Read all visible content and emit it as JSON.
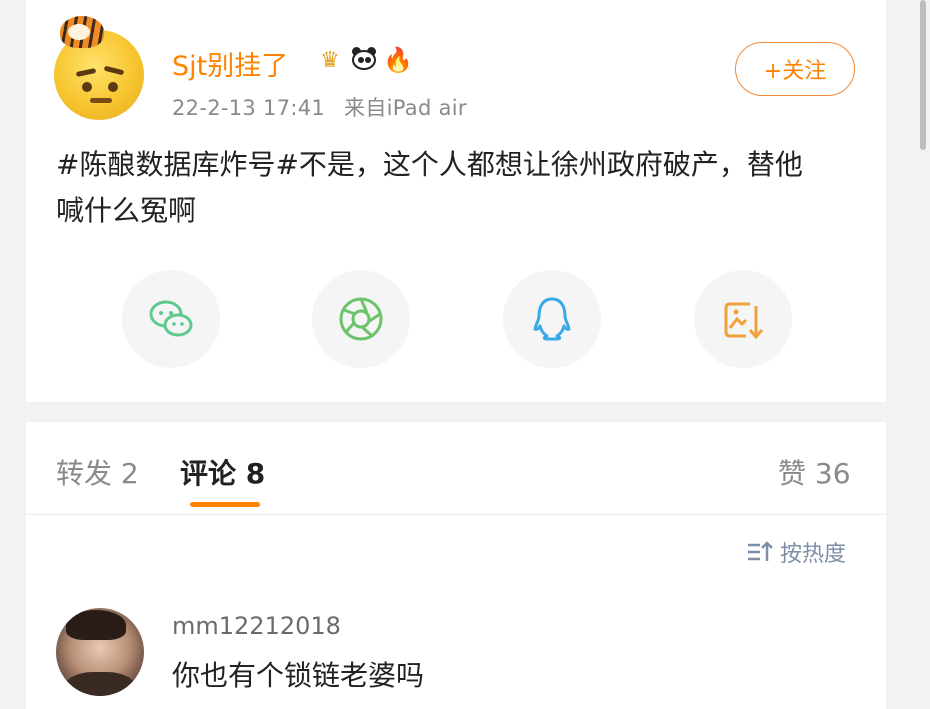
{
  "post": {
    "username": "Sjt别挂了",
    "badges": [
      "crown-badge",
      "panda-badge",
      "fire-badge"
    ],
    "timestamp": "22-2-13 17:41",
    "source": "来自iPad air",
    "follow_label": "+关注",
    "text": "#陈酿数据库炸号#不是，这个人都想让徐州政府破产，替他喊什么冤啊"
  },
  "share": [
    {
      "icon": "wechat-icon",
      "color": "#5cc98f"
    },
    {
      "icon": "moments-icon",
      "color": "#6cc36a"
    },
    {
      "icon": "qq-icon",
      "color": "#3aa7e6"
    },
    {
      "icon": "save-image-icon",
      "color": "#f0a23a"
    }
  ],
  "tabs": {
    "repost": "转发 2",
    "comments": "评论 8",
    "likes": "赞 36"
  },
  "sort_label": "按热度",
  "comments": [
    {
      "user": "mm12212018",
      "text": "你也有个锁链老婆吗"
    }
  ],
  "colors": {
    "accent": "#ff8200",
    "text": "#222222",
    "muted": "#8a8a8a"
  }
}
